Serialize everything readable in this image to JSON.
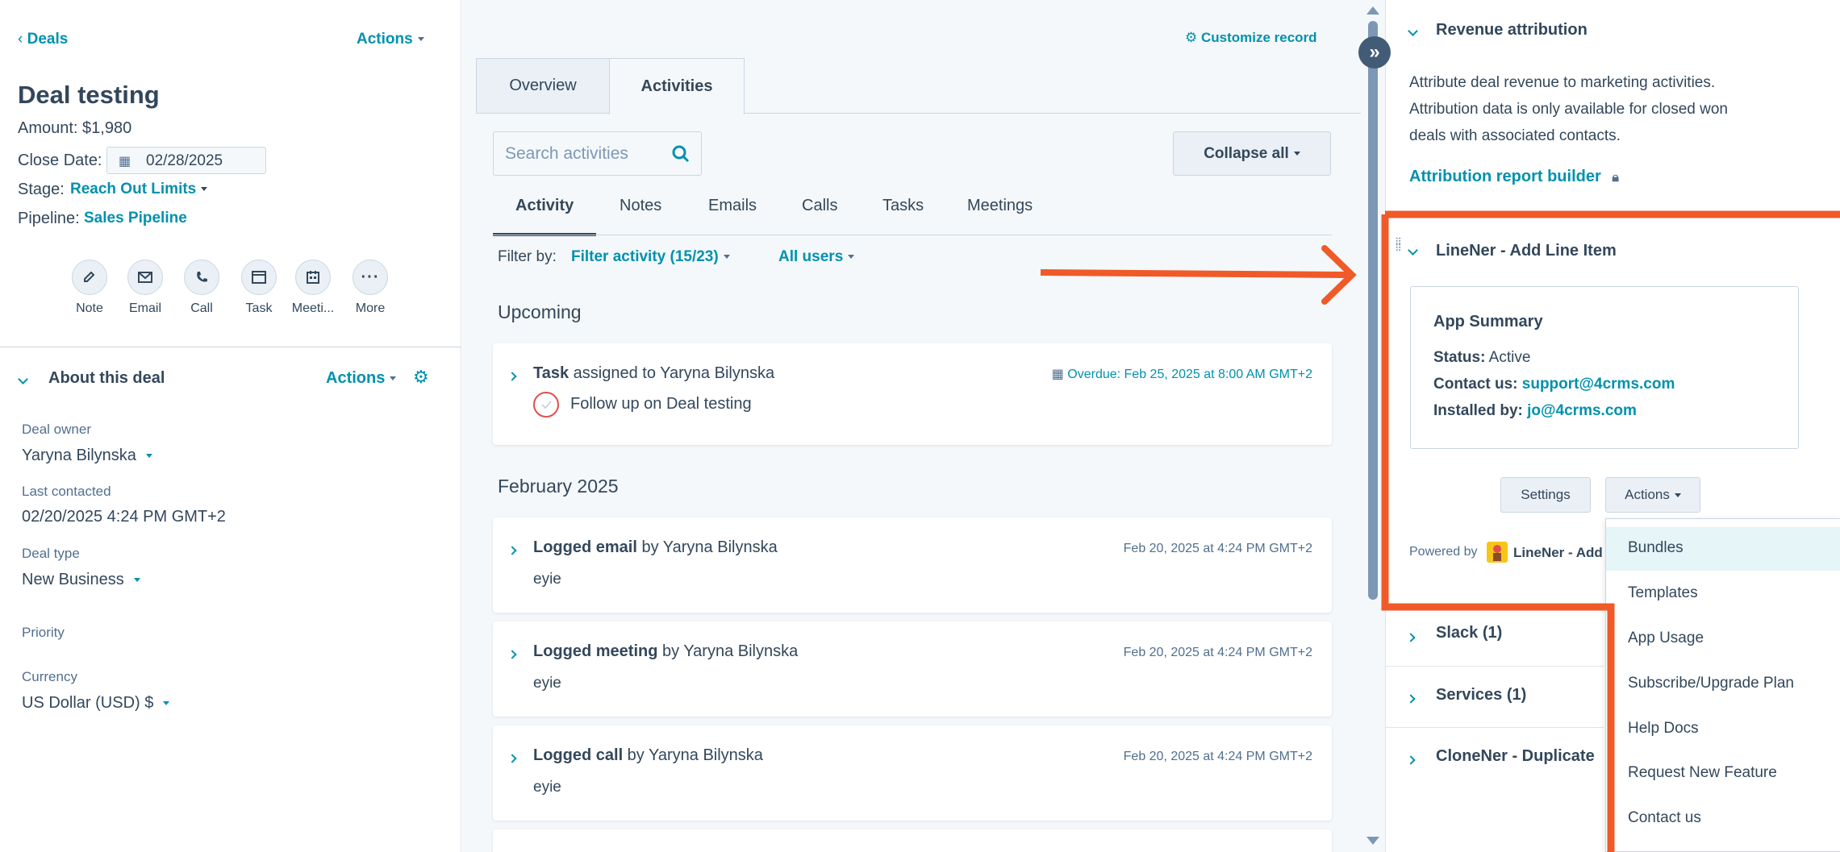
{
  "left": {
    "back_label": "Deals",
    "actions_label": "Actions",
    "title": "Deal testing",
    "amount": "Amount: $1,980",
    "close_date_label": "Close Date:",
    "close_date": "02/28/2025",
    "stage_label": "Stage:",
    "stage_value": "Reach Out Limits",
    "pipeline_label": "Pipeline:",
    "pipeline_value": "Sales Pipeline",
    "activity_buttons": [
      {
        "label": "Note",
        "icon": "note-icon"
      },
      {
        "label": "Email",
        "icon": "email-icon"
      },
      {
        "label": "Call",
        "icon": "call-icon"
      },
      {
        "label": "Task",
        "icon": "task-icon"
      },
      {
        "label": "Meeti...",
        "icon": "meeting-icon"
      },
      {
        "label": "More",
        "icon": "more-icon"
      }
    ],
    "about_title": "About this deal",
    "about_actions": "Actions",
    "properties": [
      {
        "label": "Deal owner",
        "value": "Yaryna Bilynska"
      },
      {
        "label": "Last contacted",
        "value": "02/20/2025 4:24 PM GMT+2"
      },
      {
        "label": "Deal type",
        "value": "New Business"
      },
      {
        "label": "Priority",
        "value": ""
      },
      {
        "label": "Currency",
        "value": "US Dollar (USD) $"
      }
    ]
  },
  "mid": {
    "customize": "Customize record",
    "tabs": [
      "Overview",
      "Activities"
    ],
    "search_placeholder": "Search activities",
    "collapse_all": "Collapse all",
    "subtabs": [
      "Activity",
      "Notes",
      "Emails",
      "Calls",
      "Tasks",
      "Meetings"
    ],
    "filter_by": "Filter by:",
    "filter_activity": "Filter activity (15/23)",
    "all_users": "All users",
    "upcoming": "Upcoming",
    "task_card": {
      "bold": "Task",
      "rest": " assigned to Yaryna Bilynska",
      "sub": "Follow up on Deal testing",
      "overdue": "Overdue: Feb 25, 2025 at 8:00 AM GMT+2"
    },
    "month": "February 2025",
    "activities": [
      {
        "bold": "Logged email",
        "rest": " by Yaryna Bilynska",
        "sub": "eyie",
        "ts": "Feb 20, 2025 at 4:24 PM GMT+2"
      },
      {
        "bold": "Logged meeting",
        "rest": " by Yaryna Bilynska",
        "sub": "eyie",
        "ts": "Feb 20, 2025 at 4:24 PM GMT+2"
      },
      {
        "bold": "Logged call",
        "rest": " by Yaryna Bilynska",
        "sub": "eyie",
        "ts": "Feb 20, 2025 at 4:24 PM GMT+2"
      }
    ]
  },
  "right": {
    "revenue_title": "Revenue attribution",
    "revenue_text_1": "Attribute deal revenue to marketing activities.",
    "revenue_text_2": "Attribution data is only available for closed won",
    "revenue_text_3": "deals with associated contacts.",
    "attribution_link": "Attribution report builder",
    "linener_title": "LineNer - Add Line Item",
    "app_summary": "App Summary",
    "status_label": "Status:",
    "status_value": "Active",
    "contact_label": "Contact us:",
    "contact_value": "support@4crms.com",
    "installed_label": "Installed by:",
    "installed_value": "jo@4crms.com",
    "settings_btn": "Settings",
    "actions_btn": "Actions",
    "powered_by": "Powered by",
    "powered_app": "LineNer - Add",
    "slack": "Slack (1)",
    "services": "Services (1)",
    "clonener": "CloneNer - Duplicate",
    "menu_items": [
      "Bundles",
      "Templates",
      "App Usage",
      "Subscribe/Upgrade Plan",
      "Help Docs",
      "Request New Feature",
      "Contact us"
    ]
  },
  "colors": {
    "accent": "#0091ae",
    "annotation": "#f05a28",
    "text": "#33475b",
    "overdue_icon": "#e24e4e"
  }
}
